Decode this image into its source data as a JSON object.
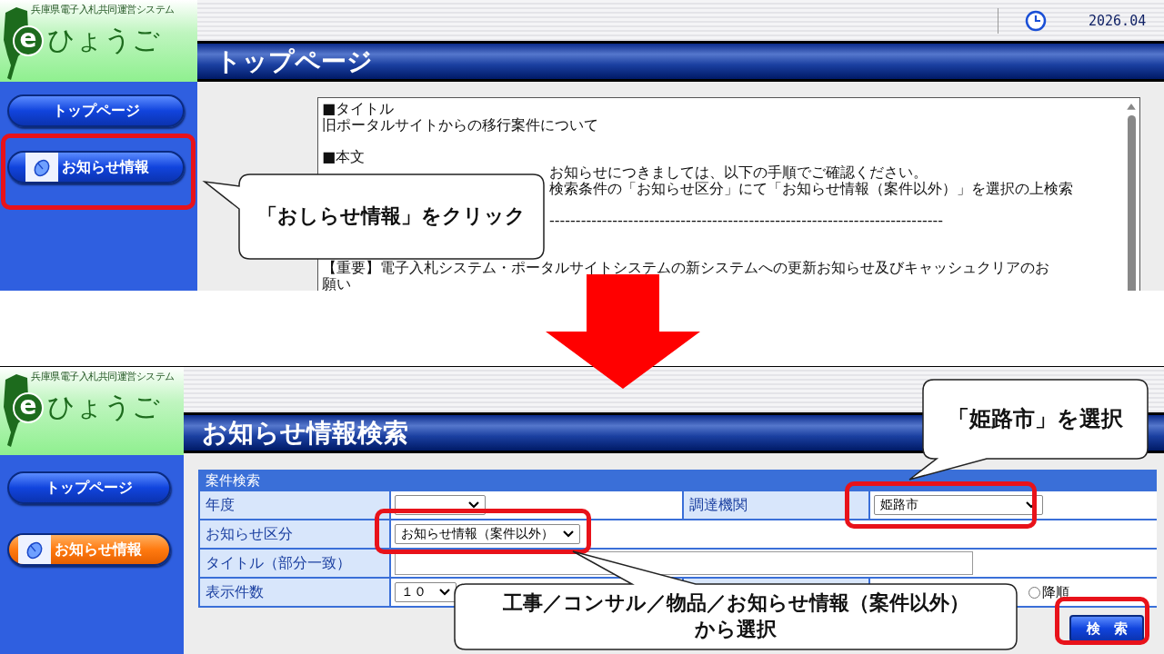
{
  "top_screen": {
    "logo": {
      "caption": "兵庫県電子入札共同運営システム",
      "letter": "e",
      "name": "ひょうご"
    },
    "date": "2026.04",
    "page_title": "トップページ",
    "nav": [
      {
        "label": "トップページ",
        "kind": "plain",
        "selected": false
      },
      {
        "label": "お知らせ情報",
        "kind": "mouse",
        "selected": false
      }
    ],
    "notice_lines": [
      {
        "kind": "text",
        "text": "■タイトル"
      },
      {
        "kind": "text",
        "text": "旧ポータルサイトからの移行案件について"
      },
      {
        "kind": "gap"
      },
      {
        "kind": "text",
        "text": "■本文"
      },
      {
        "kind": "covered",
        "text": "お知らせにつきましては、以下の手順でご確認ください。"
      },
      {
        "kind": "covered",
        "text": "検索条件の「お知らせ区分」にて「お知らせ情報（案件以外）」を選択の上検索"
      },
      {
        "kind": "gap"
      },
      {
        "kind": "covered",
        "text": "---------------------------------------------------------------------------"
      },
      {
        "kind": "gap"
      },
      {
        "kind": "gap"
      },
      {
        "kind": "text",
        "text": "【重要】電子入札システム・ポータルサイトシステムの新システムへの更新お知らせ及びキャッシュクリアのお"
      },
      {
        "kind": "text",
        "text": "願い"
      }
    ],
    "callout": {
      "lines": [
        "「おしらせ情報」をクリック"
      ]
    }
  },
  "bottom_screen": {
    "logo": {
      "caption": "兵庫県電子入札共同運営システム",
      "letter": "e",
      "name": "ひょうご"
    },
    "page_title": "お知らせ情報検索",
    "nav": [
      {
        "label": "トップページ",
        "kind": "plain",
        "selected": false
      },
      {
        "label": "お知らせ情報",
        "kind": "mouse",
        "selected": true
      }
    ],
    "form": {
      "title": "案件検索",
      "year_label": "年度",
      "agency_label": "調達機関",
      "agency_value": "姫路市",
      "category_label": "お知らせ区分",
      "category_value": "お知らせ情報（案件以外）",
      "title_label": "タイトル（部分一致）",
      "count_label": "表示件数",
      "count_value": "１０",
      "order_options": [
        {
          "label": "降順",
          "selected": false
        }
      ]
    },
    "search_button": "検　索",
    "callouts": [
      {
        "lines": [
          "「姫路市」を選択"
        ]
      },
      {
        "lines": [
          "工事／コンサル／物品／お知らせ情報（案件以外）",
          "から選択"
        ]
      }
    ]
  }
}
